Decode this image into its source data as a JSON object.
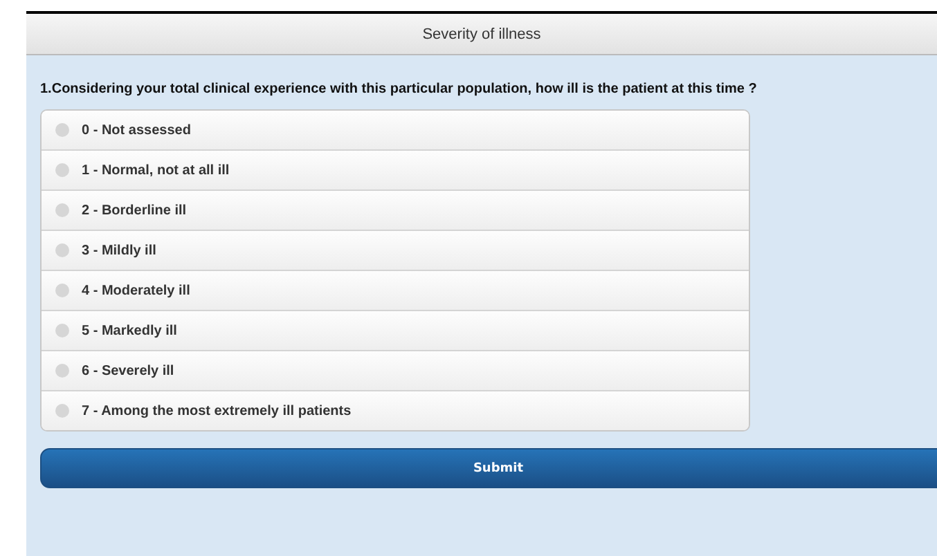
{
  "header": {
    "title": "Severity of illness"
  },
  "question": {
    "number": "1.",
    "text": "Considering your total clinical experience with this particular population, how ill is the patient at this time ?"
  },
  "options": [
    {
      "label": "0 - Not assessed",
      "selected": false
    },
    {
      "label": "1 - Normal, not at all ill",
      "selected": false
    },
    {
      "label": "2 - Borderline ill",
      "selected": false
    },
    {
      "label": "3 - Mildly ill",
      "selected": false
    },
    {
      "label": "4 - Moderately ill",
      "selected": false
    },
    {
      "label": "5 - Markedly ill",
      "selected": false
    },
    {
      "label": "6 - Severely ill",
      "selected": false
    },
    {
      "label": "7 - Among the most extremely ill patients",
      "selected": false
    }
  ],
  "submit": {
    "label": "Submit"
  }
}
